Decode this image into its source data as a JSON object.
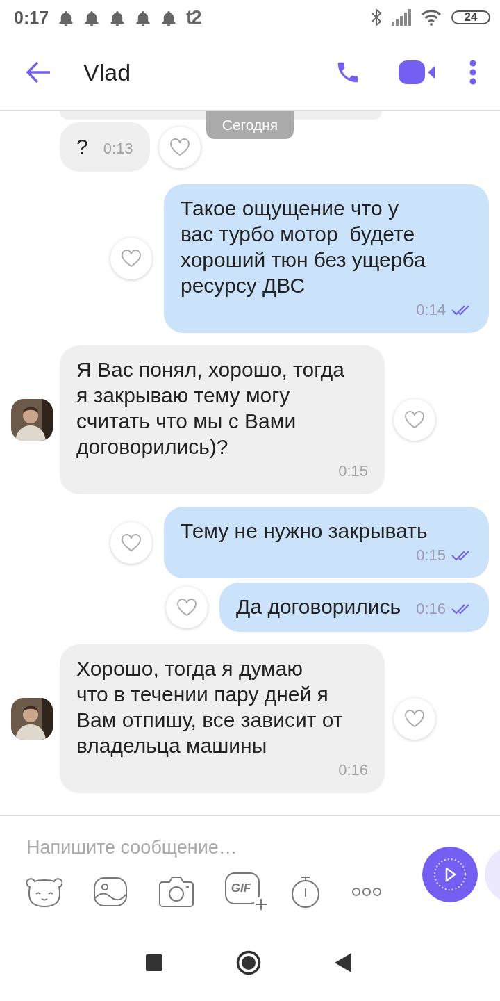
{
  "status_bar": {
    "time": "0:17",
    "notifications": [
      {
        "kind": "bell"
      },
      {
        "kind": "bell"
      },
      {
        "kind": "bell"
      },
      {
        "kind": "bell"
      },
      {
        "kind": "bell"
      },
      {
        "kind": "carrier",
        "label": "t2"
      }
    ],
    "battery": "24"
  },
  "header": {
    "title": "Vlad"
  },
  "date_label": "Сегодня",
  "messages": [
    {
      "kind": "cut_off"
    },
    {
      "kind": "incoming",
      "avatar": false,
      "text": "?",
      "time": "0:13"
    },
    {
      "kind": "outgoing",
      "text": "Такое ощущение что у\nвас турбо мотор  будете\nхороший тюн без ущерба\nресурсу ДВС",
      "time": "0:14",
      "read": true
    },
    {
      "kind": "incoming",
      "avatar": true,
      "text": "Я Вас понял, хорошо, тогда\nя закрываю тему могу\nсчитать что мы с Вами\nдоговорились)?",
      "time": "0:15"
    },
    {
      "kind": "outgoing",
      "text": "Тему не нужно закрывать",
      "time": "0:15",
      "read": true
    },
    {
      "kind": "outgoing",
      "text": "Да договорились",
      "time": "0:16",
      "read": true
    },
    {
      "kind": "incoming",
      "avatar": true,
      "text": "Хорошо, тогда я думаю\nчто в течении пару дней я\nВам отпишу, все зависит от\nвладельца машины",
      "time": "0:16"
    }
  ],
  "composer": {
    "placeholder": "Напишите сообщение…",
    "tools": [
      {
        "kind": "sticker"
      },
      {
        "kind": "gallery"
      },
      {
        "kind": "camera"
      },
      {
        "kind": "gif",
        "label": "GIF"
      },
      {
        "kind": "timer"
      },
      {
        "kind": "more"
      }
    ]
  }
}
